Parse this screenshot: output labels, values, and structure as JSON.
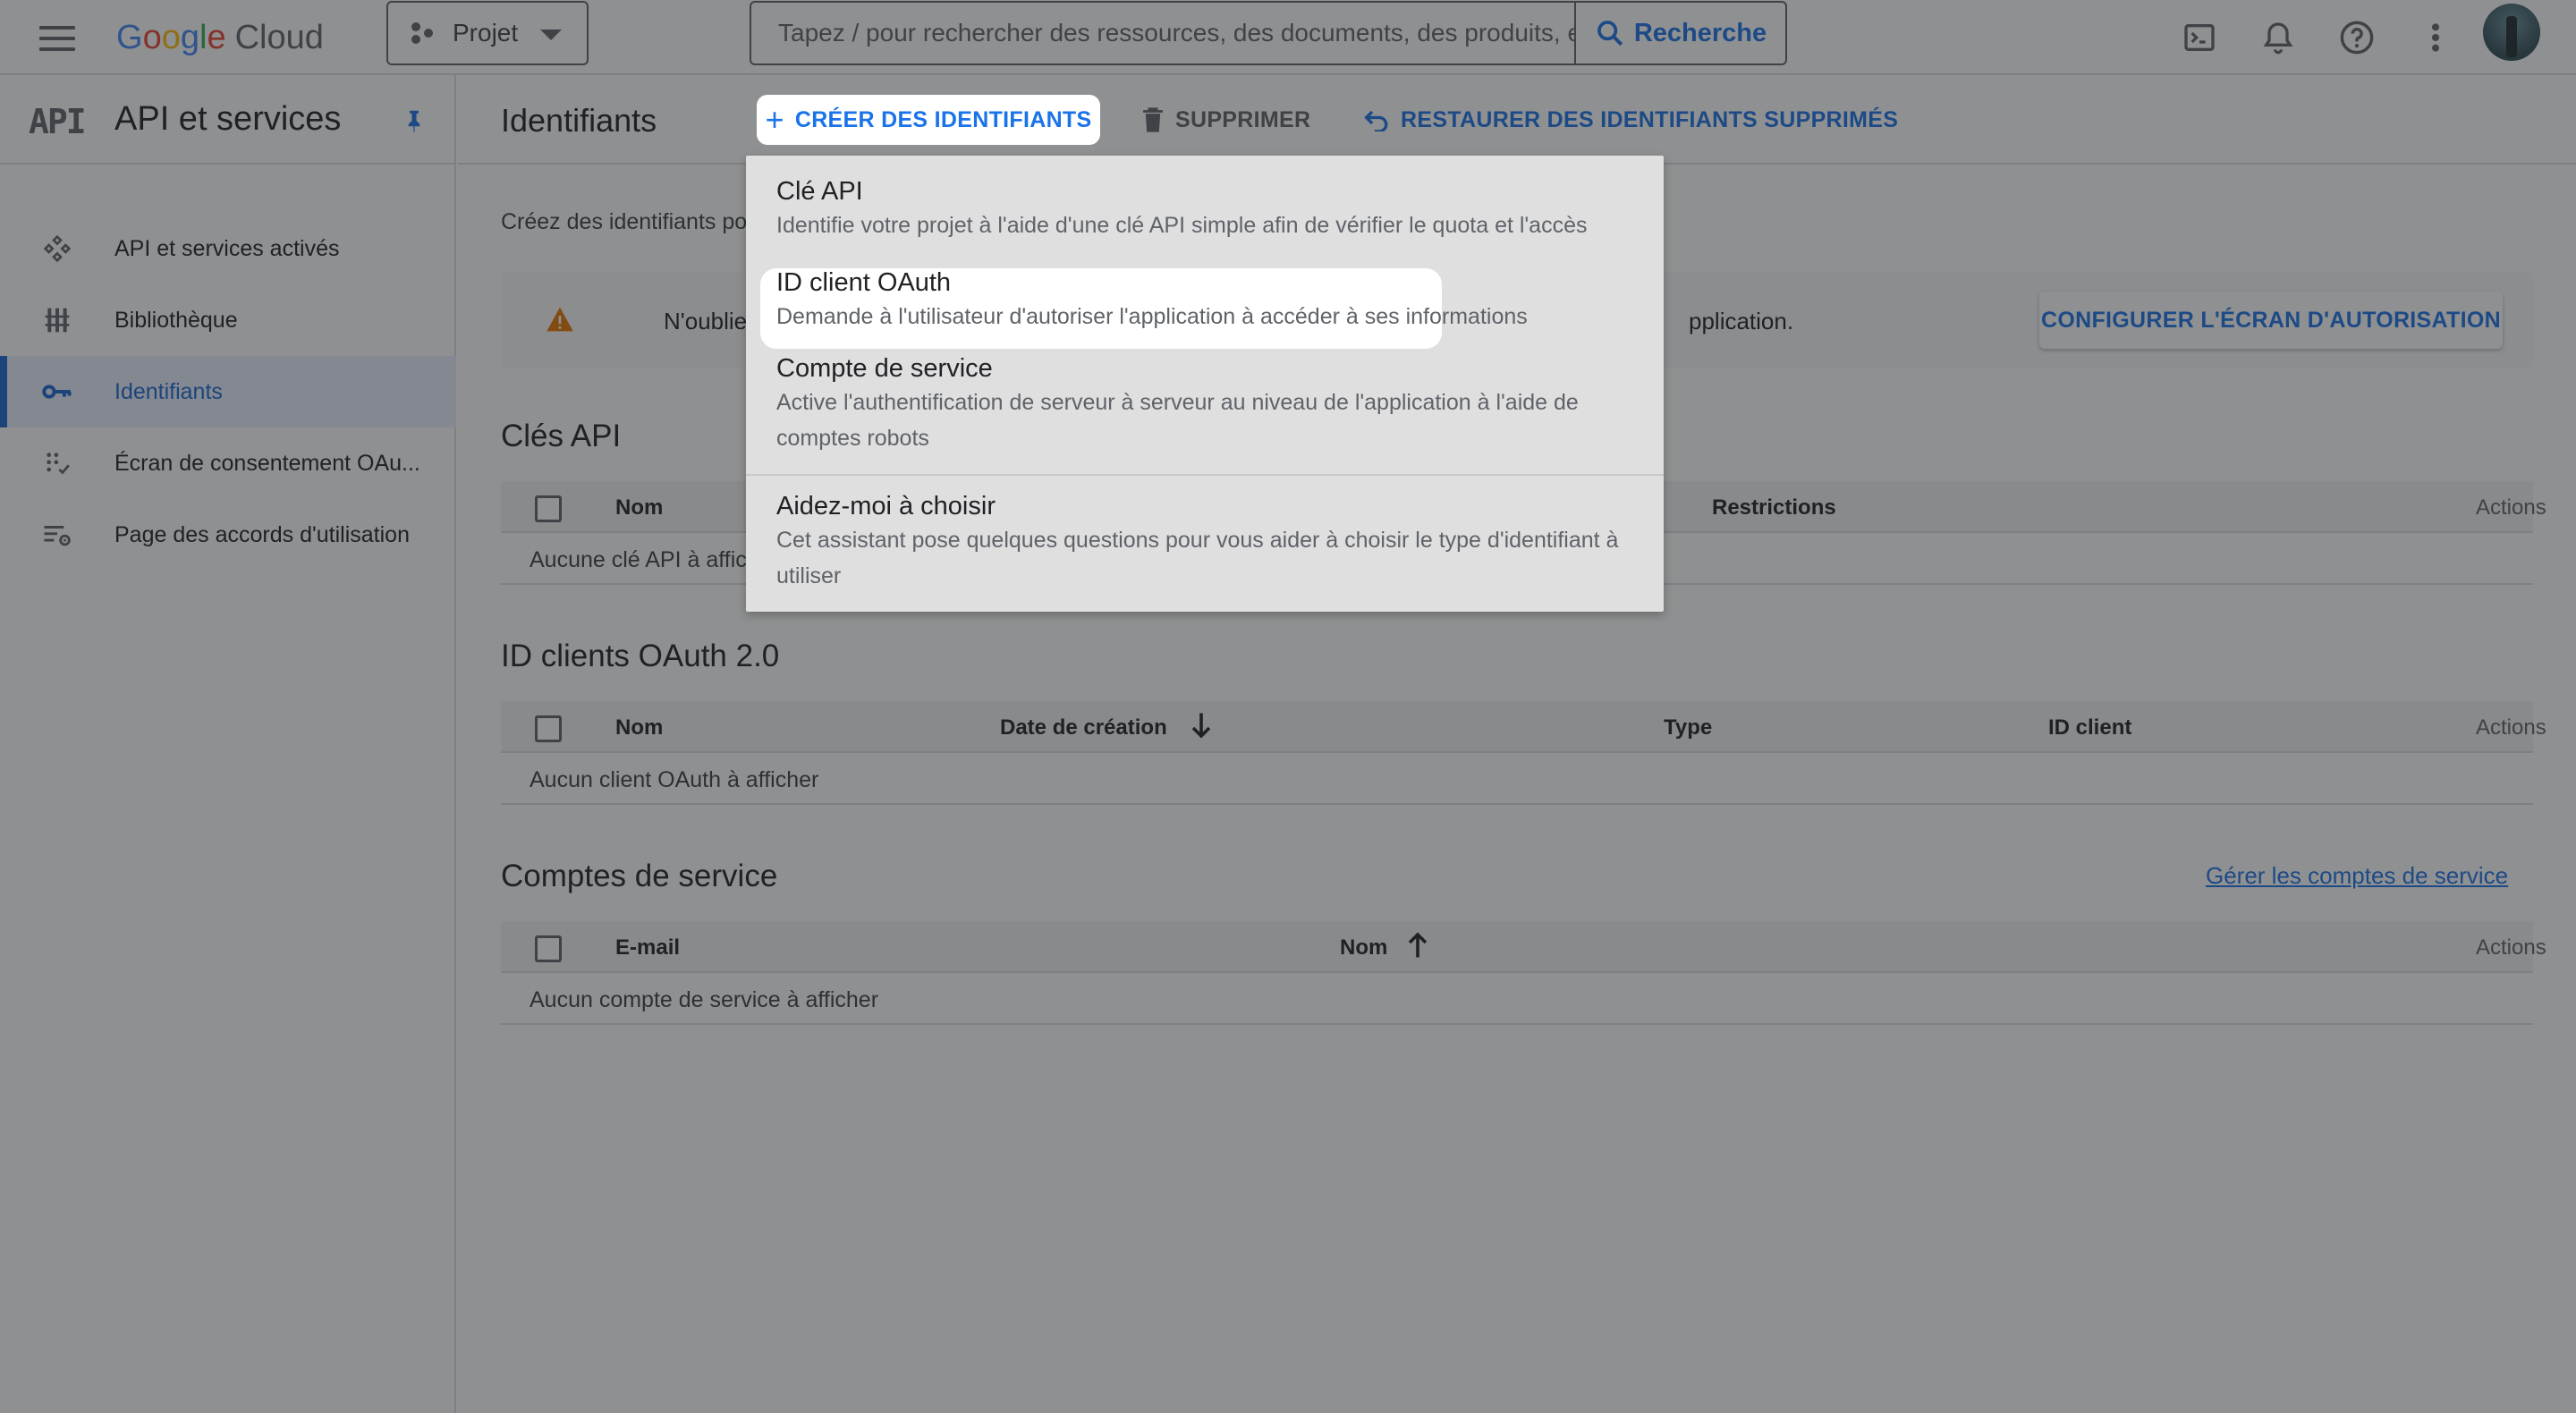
{
  "topbar": {
    "logo_google": [
      "G",
      "o",
      "o",
      "g",
      "l",
      "e"
    ],
    "logo_cloud": "Cloud",
    "project_label": "Projet",
    "search_placeholder": "Tapez / pour rechercher des ressources, des documents, des produits, etc",
    "search_button": "Recherche",
    "icons": [
      "terminal-icon",
      "bell-icon",
      "help-icon",
      "more-vert-icon"
    ]
  },
  "sidebar": {
    "logo_text": "API",
    "title": "API et services",
    "items": [
      {
        "label": "API et services activés",
        "icon": "api-hub-icon"
      },
      {
        "label": "Bibliothèque",
        "icon": "library-icon"
      },
      {
        "label": "Identifiants",
        "icon": "key-icon"
      },
      {
        "label": "Écran de consentement OAu...",
        "icon": "consent-icon"
      },
      {
        "label": "Page des accords d'utilisation",
        "icon": "settings-list-icon"
      }
    ]
  },
  "header": {
    "title": "Identifiants",
    "create_button": "CRÉER DES IDENTIFIANTS",
    "delete_button": "SUPPRIMER",
    "restore_button": "RESTAURER DES IDENTIFIANTS SUPPRIMÉS"
  },
  "intro_text": "Créez des identifiants po",
  "banner": {
    "text_start": "N'oubliez pa",
    "text_end": "pplication.",
    "button": "CONFIGURER L'ÉCRAN D'AUTORISATION"
  },
  "api_keys": {
    "title": "Clés API",
    "columns": {
      "name": "Nom",
      "restrictions": "Restrictions",
      "actions": "Actions"
    },
    "empty": "Aucune clé API à affic"
  },
  "oauth_clients": {
    "title": "ID clients OAuth 2.0",
    "columns": {
      "name": "Nom",
      "created": "Date de création",
      "type": "Type",
      "client_id": "ID client",
      "actions": "Actions"
    },
    "empty": "Aucun client OAuth à afficher"
  },
  "service_accounts": {
    "title": "Comptes de service",
    "manage_link": "Gérer les comptes de service",
    "columns": {
      "email": "E-mail",
      "name": "Nom",
      "actions": "Actions"
    },
    "empty": "Aucun compte de service à afficher"
  },
  "menu": {
    "items": [
      {
        "title": "Clé API",
        "description": "Identifie votre projet à l'aide d'une clé API simple afin de vérifier le quota et l'accès"
      },
      {
        "title": "ID client OAuth",
        "description": "Demande à l'utilisateur d'autoriser l'application à accéder à ses informations"
      },
      {
        "title": "Compte de service",
        "description": "Active l'authentification de serveur à serveur au niveau de l'application à l'aide de comptes robots"
      },
      {
        "title": "Aidez-moi à choisir",
        "description": "Cet assistant pose quelques questions pour vous aider à choisir le type d'identifiant à utiliser"
      }
    ]
  },
  "colors": {
    "accent": "#1a73e8",
    "overlay": "#202124"
  }
}
